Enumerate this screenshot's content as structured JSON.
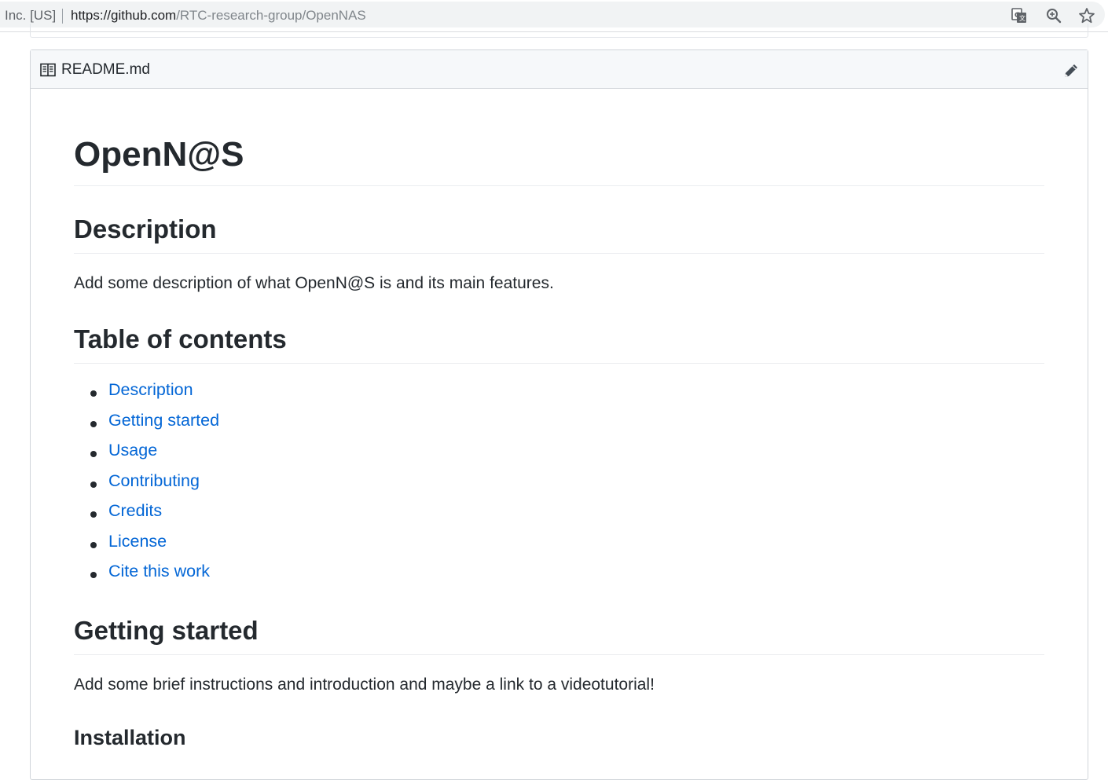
{
  "browser": {
    "secure_org": "Inc. [US]",
    "url_host": "https://github.com",
    "url_path": "/RTC-research-group/OpenNAS",
    "icons": [
      "translate-icon",
      "zoom-icon",
      "bookmark-star-icon"
    ]
  },
  "readme": {
    "filename": "README.md",
    "title": "OpenN@S",
    "sections": {
      "description": {
        "heading": "Description",
        "text": "Add some description of what OpenN@S is and its main features."
      },
      "toc": {
        "heading": "Table of contents",
        "items": [
          "Description",
          "Getting started",
          "Usage",
          "Contributing",
          "Credits",
          "License",
          "Cite this work"
        ]
      },
      "getting_started": {
        "heading": "Getting started",
        "text": "Add some brief instructions and introduction and maybe a link to a videotutorial!"
      },
      "installation": {
        "heading": "Installation"
      }
    }
  },
  "colors": {
    "link": "#0366d6",
    "text": "#24292e",
    "header_bg": "#f6f8fa",
    "border": "#d1d5da"
  }
}
